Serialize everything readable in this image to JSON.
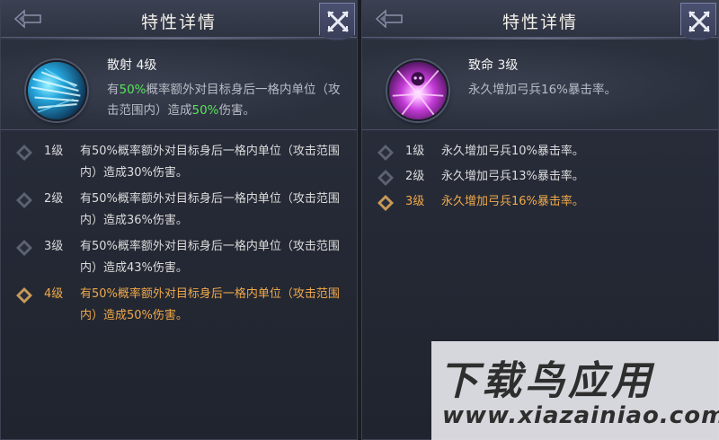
{
  "left_panel": {
    "title": "特性详情",
    "skill": {
      "name": "散射 4级",
      "desc_part1": "有",
      "desc_hl1": "50%",
      "desc_part2": "概率额外对目标身后一格内单位（攻击范围内）造成",
      "desc_hl2": "50%",
      "desc_part3": "伤害。",
      "icon": "scatter-shot-icon",
      "icon_color": "#27a9e0"
    },
    "levels": [
      {
        "level": "1级",
        "text": "有50%概率额外对目标身后一格内单位（攻击范围内）造成30%伤害。",
        "current": false
      },
      {
        "level": "2级",
        "text": "有50%概率额外对目标身后一格内单位（攻击范围内）造成36%伤害。",
        "current": false
      },
      {
        "level": "3级",
        "text": "有50%概率额外对目标身后一格内单位（攻击范围内）造成43%伤害。",
        "current": false
      },
      {
        "level": "4级",
        "text": "有50%概率额外对目标身后一格内单位（攻击范围内）造成50%伤害。",
        "current": true
      }
    ]
  },
  "right_panel": {
    "title": "特性详情",
    "skill": {
      "name": "致命 3级",
      "desc": "永久增加弓兵16%暴击率。",
      "icon": "lethal-skull-icon",
      "icon_color": "#c33ad6"
    },
    "levels": [
      {
        "level": "1级",
        "text": "永久增加弓兵10%暴击率。",
        "current": false
      },
      {
        "level": "2级",
        "text": "永久增加弓兵13%暴击率。",
        "current": false
      },
      {
        "level": "3级",
        "text": "永久增加弓兵16%暴击率。",
        "current": true
      }
    ]
  },
  "colors": {
    "highlight_green": "#58e35a",
    "current_level_orange": "#f0a94a"
  },
  "watermark": {
    "title": "下载鸟应用",
    "url": "www.xiazainiao.com"
  }
}
